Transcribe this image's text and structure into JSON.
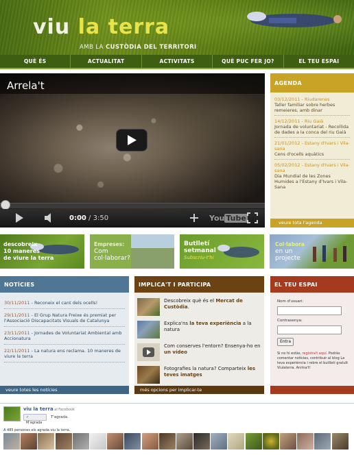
{
  "header": {
    "logo_word1": "viu",
    "logo_word2": "la terra",
    "tagline_pre": "AMB LA ",
    "tagline_bold": "CUSTÒDIA DEL TERRITORI"
  },
  "nav": [
    {
      "label": "QUÈ ÉS"
    },
    {
      "label": "ACTUALITAT"
    },
    {
      "label": "ACTIVITATS"
    },
    {
      "label": "QUÈ PUC FER JO?"
    },
    {
      "label": "EL TEU ESPAI"
    }
  ],
  "video": {
    "title": "Arrela't",
    "time_current": "0:00",
    "time_total": " / 3:50",
    "played_fraction": 0,
    "logo_you": "You",
    "logo_tube": "Tube"
  },
  "agenda": {
    "title": "AGENDA",
    "events": [
      {
        "date": "03/12/2011 - Riudarenes",
        "text": "Taller familiar sobre herbes remeieres, amb dinar"
      },
      {
        "date": "14/12/2011 - Riu Gaià",
        "text": "Jornada de voluntariat - Recollida de dades a la conca del riu Gaià"
      },
      {
        "date": "21/01/2012 - Estany d'Ivars i Vila-sana",
        "text": "Cens d'ocells aquàtics"
      },
      {
        "date": "05/02/2012 - Estany d'Ivars i Vila-sana",
        "text": "Dia Mundial de les Zones Humides a l'Estany d'Ivars i Vila-Sana"
      }
    ],
    "footer": "veure tota l'agenda"
  },
  "promos": {
    "p1_line1": "descobreix",
    "p1_line2": "10 maneres",
    "p1_line3": "de viure la terra",
    "p2_line1": "Empreses:",
    "p2_line2": "Com",
    "p2_line3": "col·laborar?",
    "p3_line1": "Butlletí",
    "p3_line2": "setmanal",
    "p3_line3": "Subscriu-t'hi",
    "p4_line1": "Col·labora",
    "p4_line2": "en un",
    "p4_line3": "projecte"
  },
  "news": {
    "title": "NOTÍCIES",
    "items": [
      {
        "date": "30/11/2011",
        "text": " - Reconeix el cant dels ocells!"
      },
      {
        "date": "29/11/2011",
        "text": " - El Grup Natura Freixe és premiat per l'Associació Discapacitats Visuals de Catalunya"
      },
      {
        "date": "23/11/2011",
        "text": " - Jornades de Voluntariat Ambiental amb Accionatura"
      },
      {
        "date": "22/11/2011",
        "text": " - La natura ens reclama. 10 maneres de viure la terra"
      }
    ],
    "footer": "veure totes les notícies"
  },
  "involve": {
    "title": "IMPLICA'T I PARTICIPA",
    "rows": [
      {
        "pre": "Descobreix què és el ",
        "bold": "Mercat de Custòdia",
        "post": "."
      },
      {
        "pre": "Explica'ns ",
        "bold": "la teva experiència",
        "post": " a la natura"
      },
      {
        "pre": "Com conserves l'entorn? Ensenya-ho en ",
        "bold": "un vídeo",
        "post": ""
      },
      {
        "pre": "Fotografies la natura? Comparteix ",
        "bold": "les teves imatges",
        "post": ""
      }
    ],
    "footer": "més opcions per implicar-te"
  },
  "myspace": {
    "title": "EL TEU ESPAI",
    "user_label": "Nom d'usuari:",
    "pass_label": "Contrasenya:",
    "user_value": "",
    "pass_value": "",
    "button": "Entra",
    "info_pre": "Si no hi estàs, ",
    "info_link": "registra't aquí",
    "info_post": ". Podràs comentar notícies, contribuir al blog La teva experiència i rebre el butlletí gratuït Viulaterra. Anima't!"
  },
  "facebook": {
    "page_name": "viu la terra",
    "page_suffix": " al Facebook",
    "like_button": "✓ M'agrada",
    "liked_text": "T'agrada.",
    "count_text": "A 485 persones els agrada viu la terra."
  },
  "colors": {
    "nav_bg": "#3e5e12",
    "agenda_accent": "#c9a325",
    "news_accent": "#4f7694",
    "involve_accent": "#6a4213",
    "myspace_accent": "#a43a1e"
  }
}
